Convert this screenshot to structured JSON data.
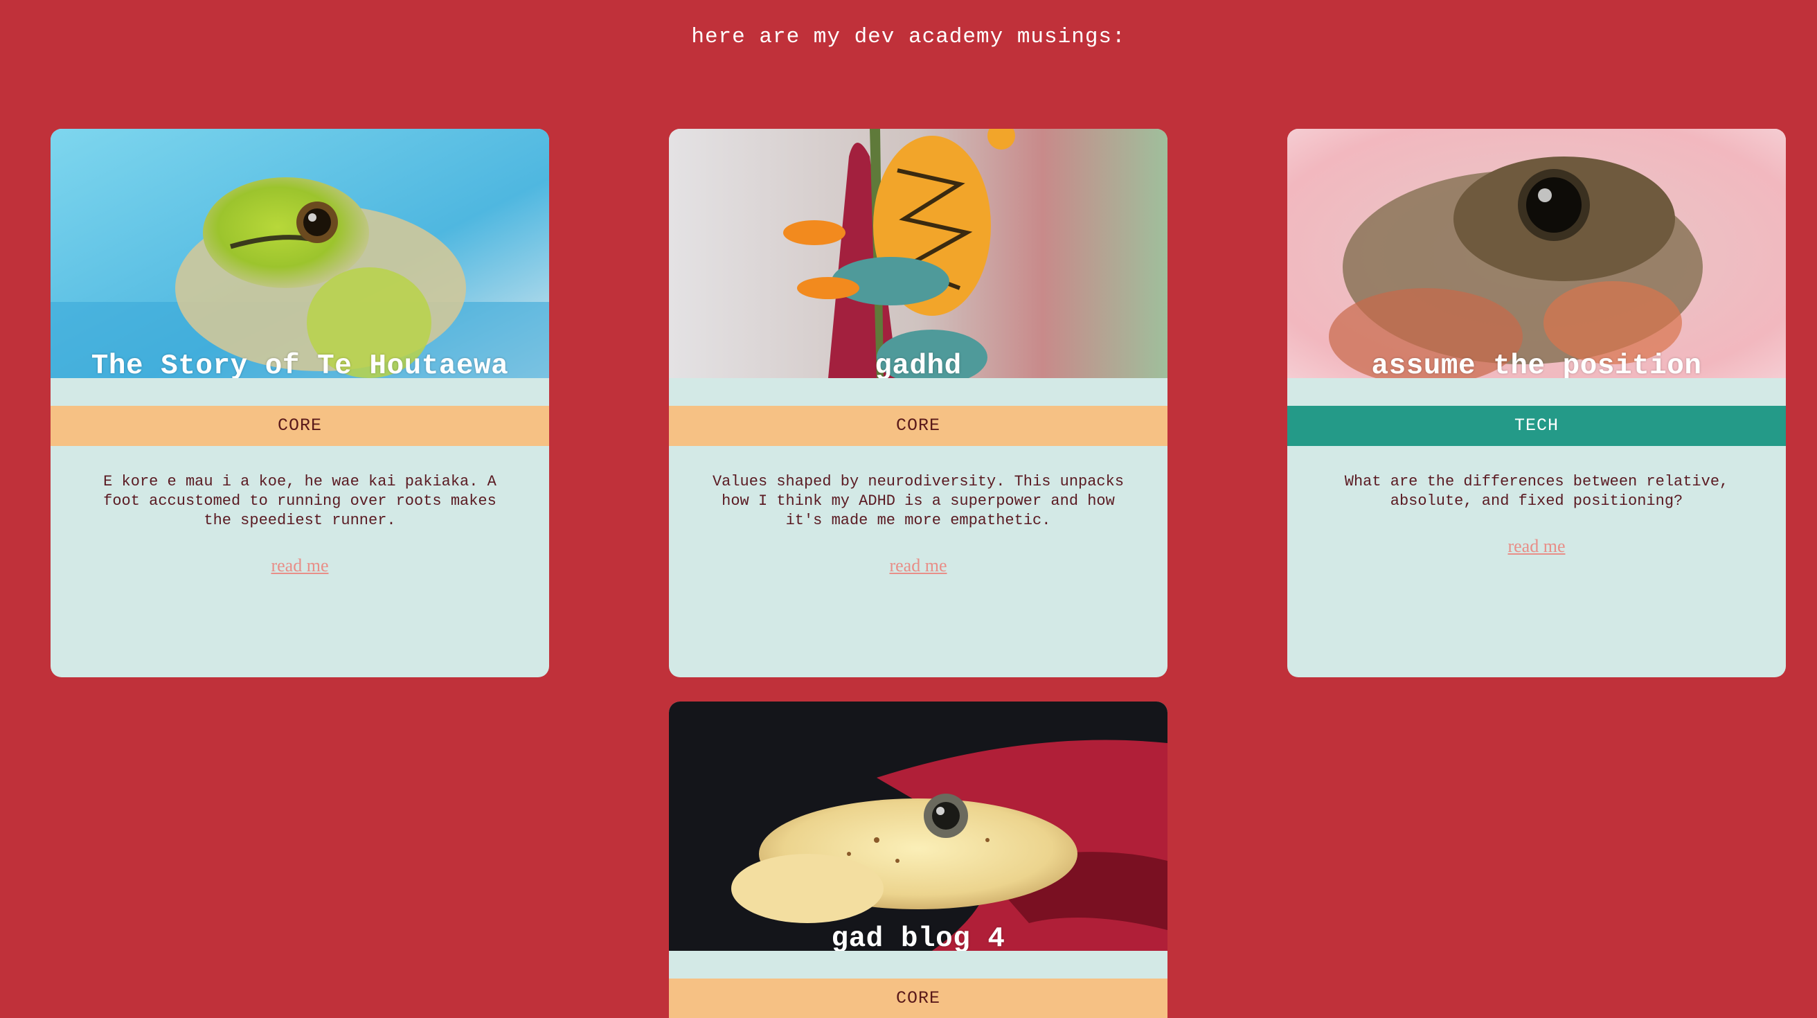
{
  "page": {
    "heading": "here are my dev academy musings:"
  },
  "colors": {
    "background": "#c0313a",
    "card": "#d3e9e6",
    "core_tag": "#f6c184",
    "tech_tag": "#249a88",
    "link": "#e88e88"
  },
  "cards": [
    {
      "title": "The Story of Te Houtaewa",
      "tag": "CORE",
      "description": "E kore e mau i a koe, he wae kai pakiaka. A foot accustomed to running over roots makes the speediest runner.",
      "link": "read me",
      "image": "green-frog-photo"
    },
    {
      "title": "gadhd",
      "tag": "CORE",
      "description": "Values shaped by neurodiversity. This unpacks how I think my ADHD is a superpower and how it's made me more empathetic.",
      "link": "read me",
      "image": "orange-tree-frog-photo"
    },
    {
      "title": "assume the position",
      "tag": "TECH",
      "description": "What are the differences between relative, absolute, and fixed positioning?",
      "link": "read me",
      "image": "brown-frog-photo"
    },
    {
      "title": "gad blog 4",
      "tag": "CORE",
      "description": "",
      "link": "",
      "image": "yellow-frog-photo"
    }
  ]
}
